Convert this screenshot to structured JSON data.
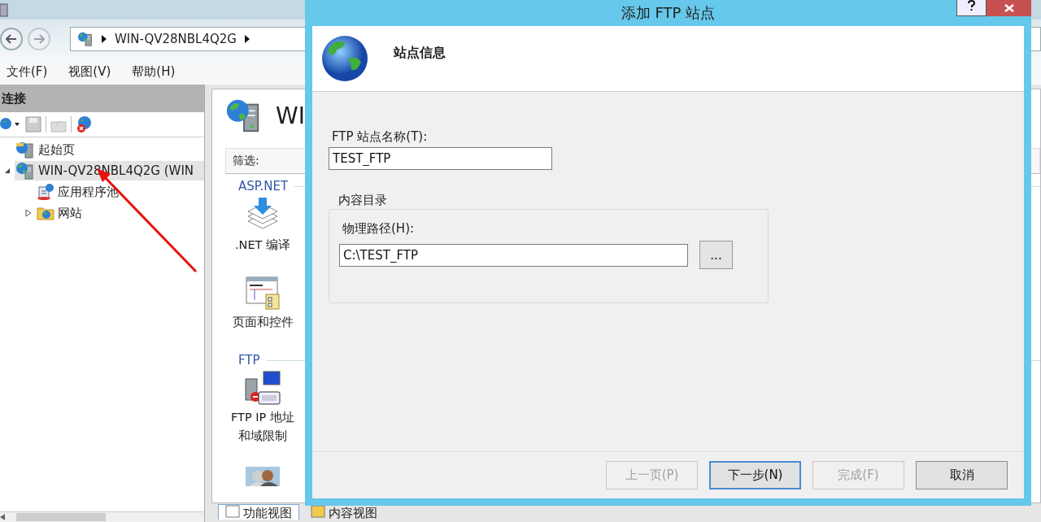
{
  "main_window": {
    "address_bar": {
      "segments": [
        "WIN-QV28NBL4Q2G"
      ]
    },
    "menu": [
      "文件(F)",
      "视图(V)",
      "帮助(H)"
    ],
    "connections_pane": {
      "title": "连接",
      "tree": [
        {
          "label": "起始页",
          "kind": "start",
          "selected": false
        },
        {
          "label": "WIN-QV28NBL4Q2G (WIN",
          "kind": "server",
          "selected": true,
          "expanded": true,
          "children": [
            {
              "label": "应用程序池",
              "kind": "pool",
              "selected": false
            },
            {
              "label": "网站",
              "kind": "sites",
              "selected": false,
              "expanded": false
            }
          ]
        }
      ]
    },
    "content_pane": {
      "heading": "WI",
      "filter_label": "筛选:",
      "groups": [
        {
          "title": "ASP.NET",
          "features": [
            {
              "kind": "compile",
              "lines": [
                ".NET 编译"
              ]
            },
            {
              "kind": "pages",
              "lines": [
                "页面和控件"
              ]
            }
          ]
        },
        {
          "title": "FTP",
          "features": [
            {
              "kind": "ftp",
              "lines": [
                "FTP IP 地址",
                "和域限制"
              ]
            },
            {
              "kind": "users"
            }
          ]
        }
      ]
    },
    "view_tabs": [
      {
        "label": "功能视图",
        "selected": true
      },
      {
        "label": "内容视图",
        "selected": false
      }
    ]
  },
  "dialog": {
    "title": "添加 FTP 站点",
    "header": "站点信息",
    "site_name": {
      "label": "FTP 站点名称(T):",
      "value": "TEST_FTP"
    },
    "content_directory": {
      "title": "内容目录",
      "path_label": "物理路径(H):",
      "path_value": "C:\\TEST_FTP",
      "browse_button": "..."
    },
    "buttons": [
      {
        "label": "上一页(P)",
        "disabled": true,
        "default": false
      },
      {
        "label": "下一步(N)",
        "disabled": false,
        "default": true
      },
      {
        "label": "完成(F)",
        "disabled": true,
        "default": false
      },
      {
        "label": "取消",
        "disabled": false,
        "default": false
      }
    ]
  }
}
